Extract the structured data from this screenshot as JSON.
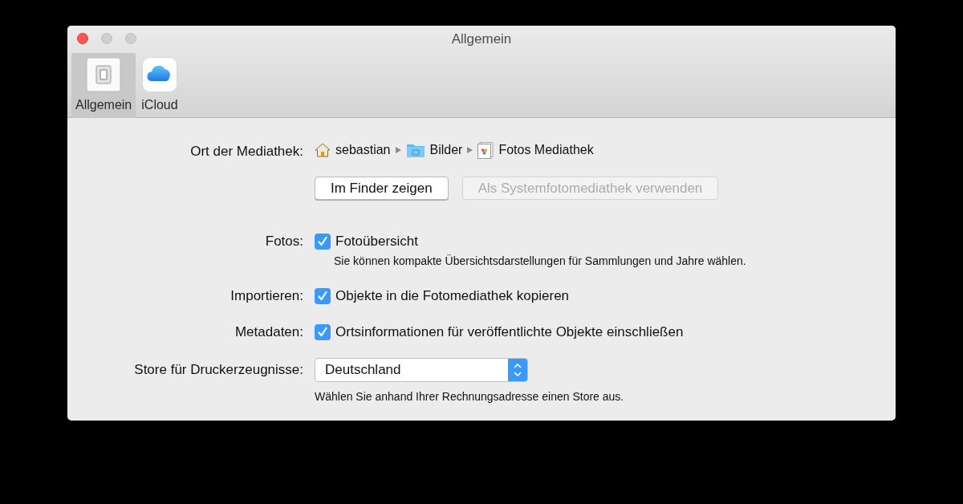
{
  "window": {
    "title": "Allgemein"
  },
  "toolbar": {
    "items": [
      {
        "label": "Allgemein",
        "kind": "general",
        "selected": true
      },
      {
        "label": "iCloud",
        "kind": "cloud",
        "selected": false
      }
    ]
  },
  "library": {
    "label": "Ort der Mediathek:",
    "path": [
      {
        "name": "sebastian",
        "kind": "home"
      },
      {
        "name": "Bilder",
        "kind": "folder"
      },
      {
        "name": "Fotos Mediathek",
        "kind": "photos"
      }
    ],
    "buttons": [
      {
        "label": "Im Finder zeigen",
        "disabled": false
      },
      {
        "label": "Als Systemfotomediathek verwenden",
        "disabled": true
      }
    ]
  },
  "options": [
    {
      "label": "Fotos:",
      "text": "Fotoübersicht",
      "checked": true,
      "hint": "Sie können kompakte Übersichtsdarstellungen für Sammlungen und Jahre wählen."
    },
    {
      "label": "Importieren:",
      "text": "Objekte in die Fotomediathek kopieren",
      "checked": true
    },
    {
      "label": "Metadaten:",
      "text": "Ortsinformationen für veröffentlichte Objekte einschließen",
      "checked": true
    }
  ],
  "store": {
    "label": "Store für Druckerzeugnisse:",
    "value": "Deutschland",
    "hint": "Wählen Sie anhand Ihrer Rechnungsadresse einen Store aus."
  }
}
